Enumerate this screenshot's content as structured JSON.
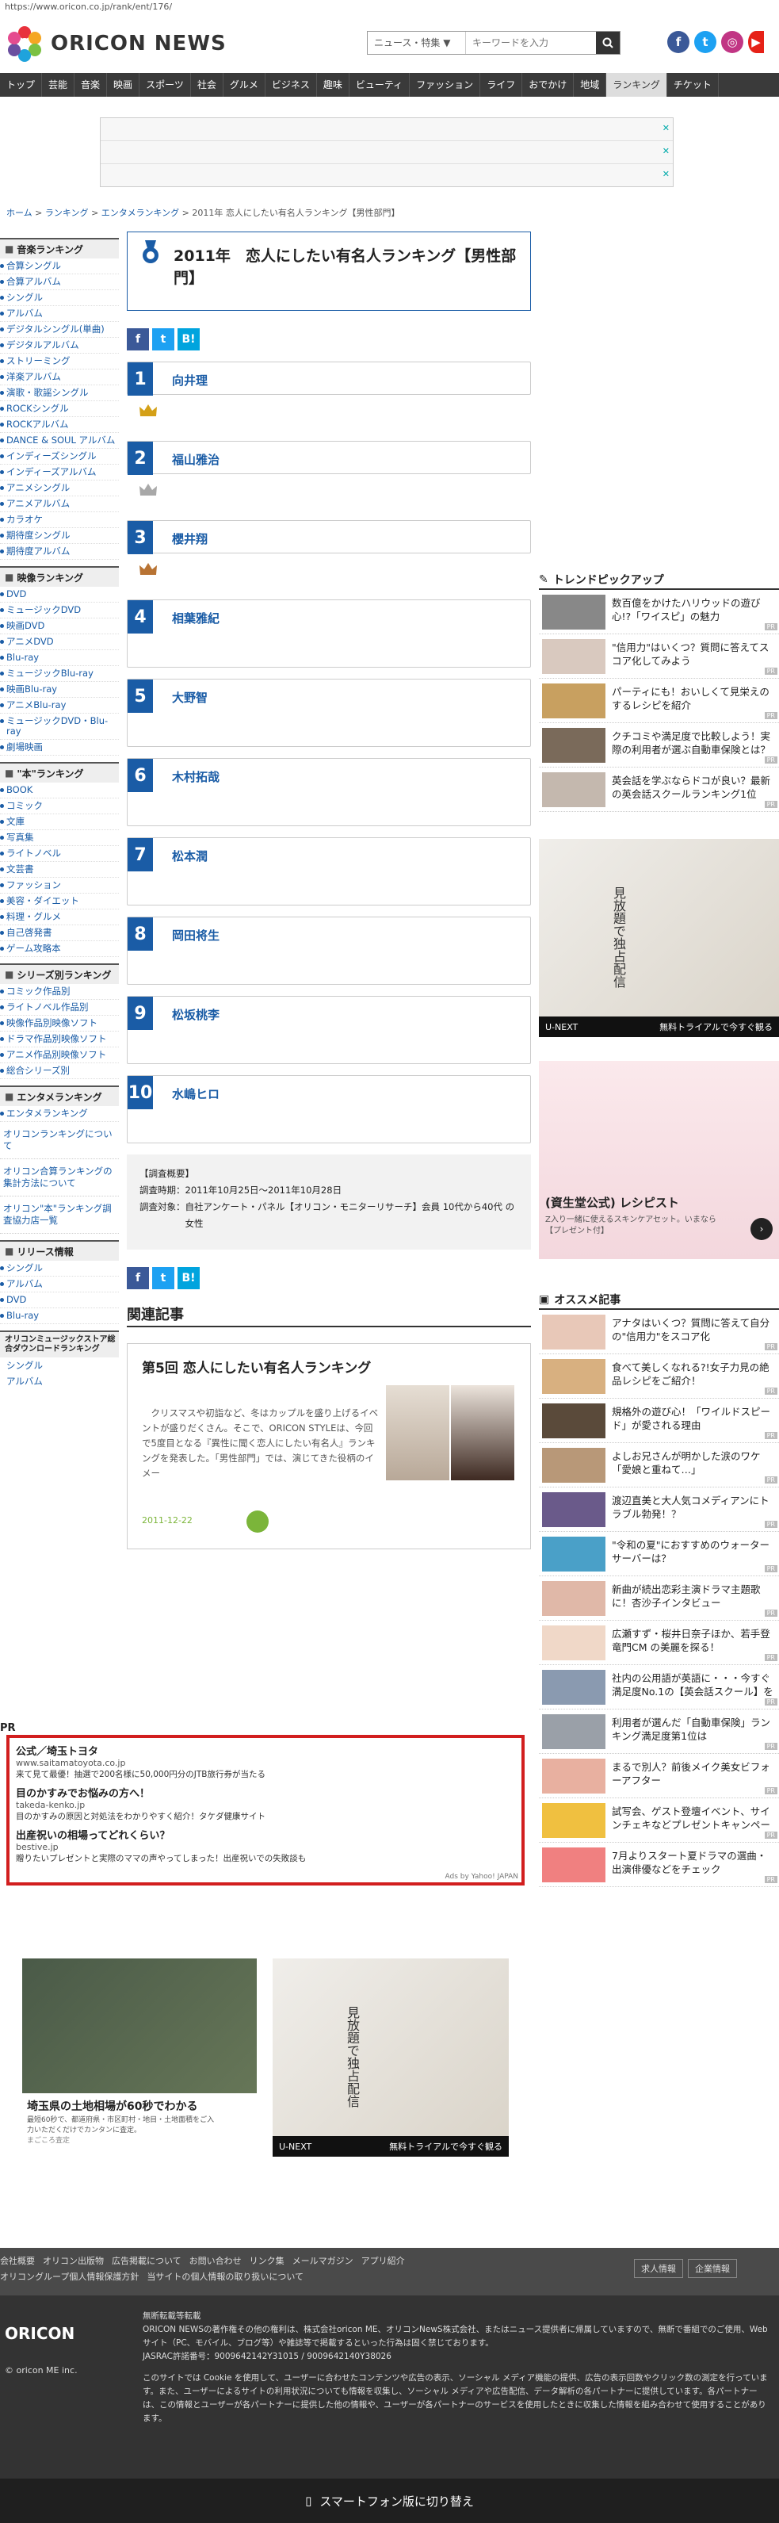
{
  "url": "https://www.oricon.co.jp/rank/ent/176/",
  "header": {
    "logo": "ORICON NEWS",
    "search_category": "ニュース・特集 ▼",
    "search_placeholder": "キーワードを入力"
  },
  "nav": [
    "トップ",
    "芸能",
    "音楽",
    "映画",
    "スポーツ",
    "社会",
    "グルメ",
    "ビジネス",
    "趣味",
    "ビューティ",
    "ファッション",
    "ライフ",
    "おでかけ",
    "地域",
    "ランキング",
    "チケット"
  ],
  "breadcrumb": {
    "home": "ホーム",
    "ranking": "ランキング",
    "ent": "エンタメランキング",
    "sep": ">",
    "current": "2011年 恋人にしたい有名人ランキング【男性部門】"
  },
  "sidebar": {
    "music_head": "音楽ランキング",
    "music": [
      "合算シングル",
      "合算アルバム",
      "シングル",
      "アルバム",
      "デジタルシングル(単曲)",
      "デジタルアルバム",
      "ストリーミング",
      "洋楽アルバム",
      "演歌・歌謡シングル",
      "ROCKシングル",
      "ROCKアルバム",
      "DANCE & SOUL アルバム",
      "インディーズシングル",
      "インディーズアルバム",
      "アニメシングル",
      "アニメアルバム",
      "カラオケ",
      "期待度シングル",
      "期待度アルバム"
    ],
    "video_head": "映像ランキング",
    "video": [
      "DVD",
      "ミュージックDVD",
      "映画DVD",
      "アニメDVD",
      "Blu-ray",
      "ミュージックBlu-ray",
      "映画Blu-ray",
      "アニメBlu-ray",
      "ミュージックDVD・Blu-ray",
      "劇場映画"
    ],
    "book_head": "\"本\"ランキング",
    "book": [
      "BOOK",
      "コミック",
      "文庫",
      "写真集",
      "ライトノベル",
      "文芸書",
      "ファッション",
      "美容・ダイエット",
      "料理・グルメ",
      "自己啓発書",
      "ゲーム攻略本"
    ],
    "series_head": "シリーズ別ランキング",
    "series": [
      "コミック作品別",
      "ライトノベル作品別",
      "映像作品別映像ソフト",
      "ドラマ作品別映像ソフト",
      "アニメ作品別映像ソフト",
      "総合シリーズ別"
    ],
    "ent_head": "エンタメランキング",
    "ent": [
      "エンタメランキング"
    ],
    "links": [
      "オリコンランキングについて",
      "オリコン合算ランキングの集計方法について",
      "オリコン\"本\"ランキング調査協力店一覧"
    ],
    "release_head": "リリース情報",
    "release": [
      "シングル",
      "アルバム",
      "DVD",
      "Blu-ray"
    ],
    "store_head": "オリコンミュージックストア総合ダウンロードランキング",
    "store": [
      "シングル",
      "アルバム"
    ]
  },
  "main": {
    "title": "2011年　恋人にしたい有名人ランキング【男性部門】",
    "share": [
      "f",
      "t",
      "B!"
    ],
    "ranks": [
      {
        "num": "1",
        "name": "向井理"
      },
      {
        "num": "2",
        "name": "福山雅治"
      },
      {
        "num": "3",
        "name": "櫻井翔"
      },
      {
        "num": "4",
        "name": "相葉雅紀"
      },
      {
        "num": "5",
        "name": "大野智"
      },
      {
        "num": "6",
        "name": "木村拓哉"
      },
      {
        "num": "7",
        "name": "松本潤"
      },
      {
        "num": "8",
        "name": "岡田将生"
      },
      {
        "num": "9",
        "name": "松坂桃李"
      },
      {
        "num": "10",
        "name": "水嶋ヒロ"
      }
    ],
    "survey": {
      "head": "【調査概要】",
      "period_label": "調査時期：",
      "period": "2011年10月25日～2011年10月28日",
      "target_label": "調査対象：",
      "target": "自社アンケート・パネル【オリコン・モニターリサーチ】会員 10代から40代 の 女性"
    },
    "related_head": "関連記事",
    "related": {
      "title": "第5回 恋人にしたい有名人ランキング",
      "body": "クリスマスや初詣など、冬はカップルを盛り上げるイベントが盛りだくさん。そこで、ORICON STYLEは、今回で5度目となる『異性に聞く恋人にしたい有名人』ランキングを発表した。「男性部門」では、演じてきた役柄のイメー",
      "date": "2011-12-22"
    }
  },
  "right": {
    "trend_head": "トレンドピックアップ",
    "trends": [
      "数百億をかけたハリウッドの遊び心!?「ワイスピ」の魅力",
      "\"信用力\"はいくつ？質問に答えてスコア化してみよう",
      "パーティにも！おいしくて見栄えのするレシピを紹介",
      "クチコミや満足度で比較しよう！実際の利用者が選ぶ自動車保険とは？",
      "英会話を学ぶならドコが良い？最新の英会話スクールランキング1位は…!?"
    ],
    "pr": "PR",
    "ad_unext": "U-NEXT",
    "ad_unext_sub": "無料トライアルで今すぐ観る",
    "ad_title": "見放題で独占配信",
    "ad2_title": "(資生堂公式) レシピスト",
    "ad2_sub": "Z入り一緒に使えるスキンケアセット。いまなら【プレゼント付】",
    "osusume_head": "オススメ記事",
    "osusume": [
      "アナタはいくつ？質問に答えて自分の\"信用力\"をスコア化",
      "食べて美しくなれる?!女子力見の絶品レシピをご紹介！",
      "規格外の遊び心！「ワイルドスピード」が愛される理由",
      "よしお兄さんが明かした涙のワケ「愛娘と重ねて…」",
      "渡辺直美と大人気コメディアンにトラブル勃発！？",
      "\"令和の夏\"におすすめのウォーターサーバーは？",
      "新曲が続出恋彩主演ドラマ主題歌に！杏沙子インタビュー",
      "広瀬すず・桜井日奈子ほか、若手登竜門CM の美麗を探る！",
      "社内の公用語が英語に・・・今すぐ満足度No.1の【英会話スクール】をチェック！",
      "利用者が選んだ「自動車保険」ランキング満足度第1位は",
      "まるで別人？前後メイク美女ビフォーアフター",
      "試写会、ゲスト登壇イベント、サインチェキなどプレゼントキャンペーン実施中！",
      "7月よりスタート夏ドラマの選曲・出演俳優などをチェック"
    ]
  },
  "pr_block": {
    "label": "PR",
    "items": [
      {
        "title": "公式／埼玉トヨタ",
        "url": "www.saitamatoyota.co.jp",
        "desc": "来て見て最優！抽選で200名様に50,000円分のJTB旅行券が当たる"
      },
      {
        "title": "目のかすみでお悩みの方へ！",
        "url": "takeda-kenko.jp",
        "desc": "目のかすみの原因と対処法をわかりやすく紹介！タケダ健康サイト"
      },
      {
        "title": "出産祝いの相場ってどれくらい？",
        "url": "bestive.jp",
        "desc": "贈りたいプレゼントと実際のママの声やってしまった！出産祝いでの失敗談も"
      }
    ],
    "by": "Ads by Yahoo! JAPAN"
  },
  "bottom_ads": {
    "map_title": "埼玉県の土地相場が60秒でわかる",
    "map_desc": "最短60秒で、都道府県・市区町村・地目・土地面積をご入力いただくだけでカンタンに査定。",
    "map_src": "まごころ査定",
    "unext": "U-NEXT",
    "unext_sub": "無料トライアルで今すぐ観る",
    "unext_title": "見放題で独占配信"
  },
  "footer": {
    "links": [
      "会社概要",
      "オリコン出版物",
      "広告掲載について",
      "お問い合わせ",
      "リンク集",
      "メールマガジン",
      "アプリ紹介"
    ],
    "links2": [
      "オリコングループ個人情報保護方針",
      "当サイトの個人情報の取り扱いについて"
    ],
    "right_links": [
      "求人情報",
      "企業情報"
    ],
    "logo": "ORICON",
    "copyright": "© oricon ME inc.",
    "notice_head": "無断転載等転載",
    "notice": "ORICON NEWSの著作権その他の権利は、株式会社oricon ME、オリコンNewS株式会社、またはニュース提供者に帰属していますので、無断で番組でのご使用、Webサイト（PC、モバイル、ブログ等）や雑誌等で掲載するといった行為は固く禁じております。",
    "jasrac": "JASRAC許諾番号：9009642142Y31015 / 9009642140Y38026",
    "cookie": "このサイトでは Cookie を使用して、ユーザーに合わせたコンテンツや広告の表示、ソーシャル メディア機能の提供、広告の表示回数やクリック数の測定を行っています。また、ユーザーによるサイトの利用状況についても情報を収集し、ソーシャル メディアや広告配信、データ解析の各パートナーに提供しています。各パートナーは、この情報とユーザーが各パートナーに提供した他の情報や、ユーザーが各パートナーのサービスを使用したときに収集した情報を組み合わせて使用することがあります。",
    "sp": "スマートフォン版に切り替え"
  },
  "colors": {
    "brand": "#1a5ca6",
    "nav": "#3a3a3a",
    "pr_border": "#d21e1e"
  }
}
